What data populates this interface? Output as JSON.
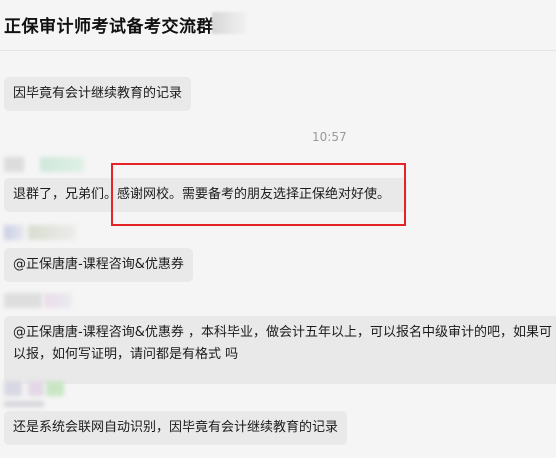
{
  "header": {
    "title": "正保审计师考试备考交流群"
  },
  "chat": {
    "timestamp": "10:57",
    "messages": [
      {
        "text": "因毕竟有会计继续教育的记录"
      },
      {
        "text": "退群了，兄弟们。感谢网校。需要备考的朋友选择正保绝对好使。"
      },
      {
        "text": "@正保唐唐-课程咨询&优惠券"
      },
      {
        "line1": "@正保唐唐-课程咨询&优惠券 ，本科毕业，做会计五年以上，可以报名中级审计的吧，如果可",
        "line2": "以报，如何写证明，请问都是有格式 吗"
      },
      {
        "text": "还是系统会联网自动识别，因毕竟有会计继续教育的记录"
      }
    ]
  },
  "colors": {
    "highlight": "#e5242a",
    "bubble": "#e9e9e9",
    "background": "#f5f5f5"
  }
}
